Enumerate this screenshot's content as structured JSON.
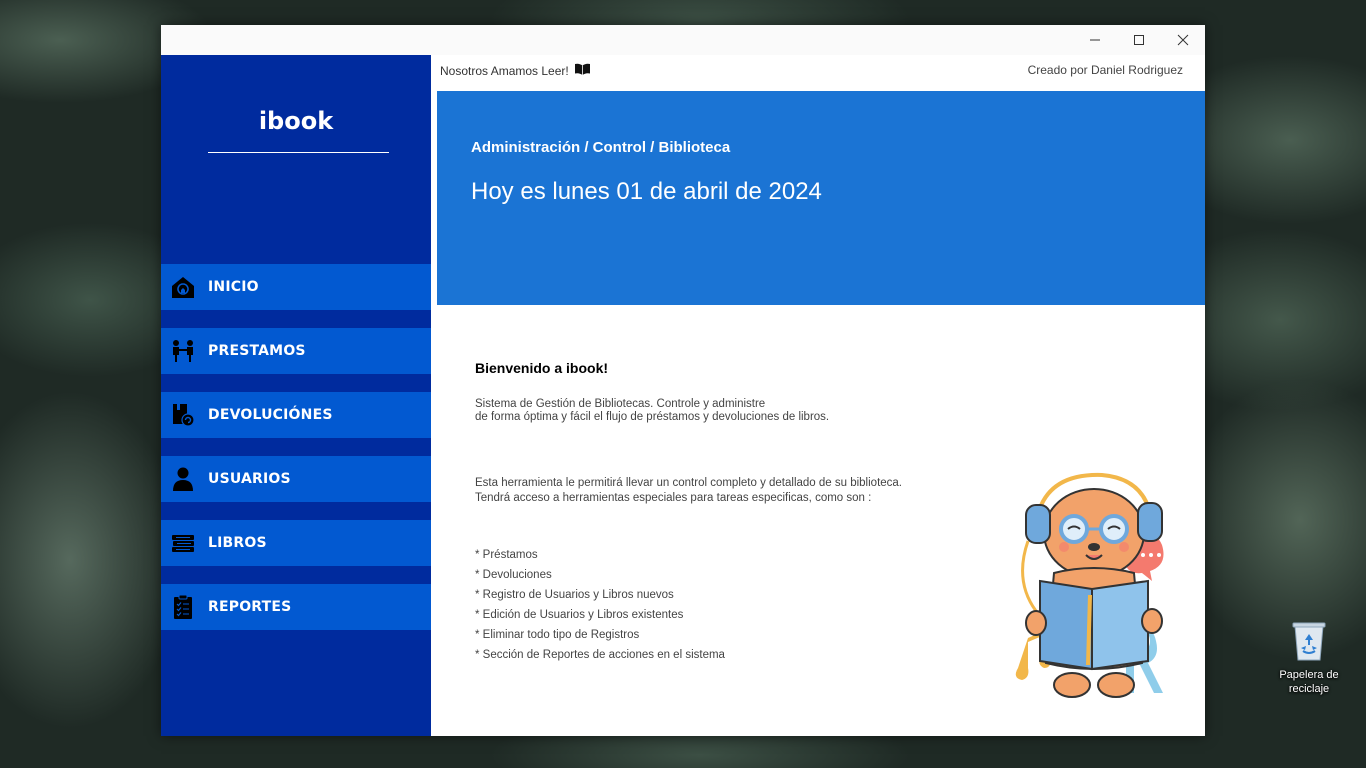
{
  "window": {
    "controls": {
      "minimize": "minimize-icon",
      "maximize": "maximize-icon",
      "close": "close-icon"
    }
  },
  "sidebar": {
    "logo": "ibook",
    "items": [
      {
        "label": "INICIO",
        "icon": "home-icon"
      },
      {
        "label": "PRESTAMOS",
        "icon": "loan-icon"
      },
      {
        "label": "DEVOLUCIÓNES",
        "icon": "return-icon"
      },
      {
        "label": "USUARIOS",
        "icon": "user-icon"
      },
      {
        "label": "LIBROS",
        "icon": "books-icon"
      },
      {
        "label": "REPORTES",
        "icon": "report-icon"
      }
    ]
  },
  "topbar": {
    "tagline": "Nosotros Amamos Leer!",
    "author": "Creado por Daniel Rodriguez"
  },
  "header": {
    "breadcrumb": "Administración / Control / Biblioteca",
    "date": "Hoy es lunes 01 de abril de 2024"
  },
  "main": {
    "welcome": "Bienvenido a ibook!",
    "intro": [
      "Sistema de Gestión de Bibliotecas. Controle y administre",
      "de forma óptima y fácil el flujo de préstamos y devoluciones de libros."
    ],
    "tools": [
      "Esta herramienta le permitirá llevar un control completo y detallado de su biblioteca.",
      "Tendrá acceso a herramientas especiales para tareas especificas, como son :"
    ],
    "features": [
      "* Préstamos",
      "* Devoluciones",
      "* Registro de Usuarios y Libros nuevos",
      "* Edición de Usuarios y Libros existentes",
      "* Eliminar todo tipo de Registros",
      "* Sección de Reportes de acciones en el sistema"
    ]
  },
  "desktop": {
    "recycle_bin": "Papelera de reciclaje"
  },
  "colors": {
    "sidebar": "#002b9e",
    "nav_item": "#0259d1",
    "header": "#1b74d4"
  }
}
